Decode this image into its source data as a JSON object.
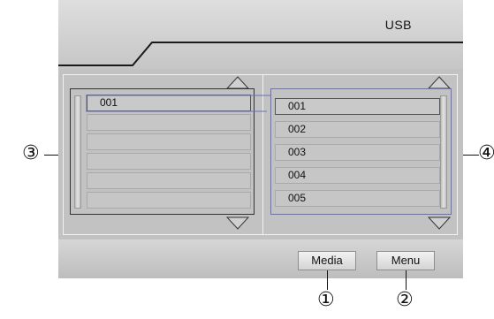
{
  "header": {
    "title": "USB"
  },
  "left_panel": {
    "items": [
      "001",
      "",
      "",
      "",
      "",
      ""
    ]
  },
  "right_panel": {
    "items": [
      "001",
      "002",
      "003",
      "004",
      "005"
    ]
  },
  "buttons": {
    "media": "Media",
    "menu": "Menu"
  },
  "callouts": {
    "c1": "①",
    "c2": "②",
    "c3": "③",
    "c4": "④"
  },
  "icons": {
    "up": "triangle-up-icon",
    "down": "triangle-down-icon"
  }
}
